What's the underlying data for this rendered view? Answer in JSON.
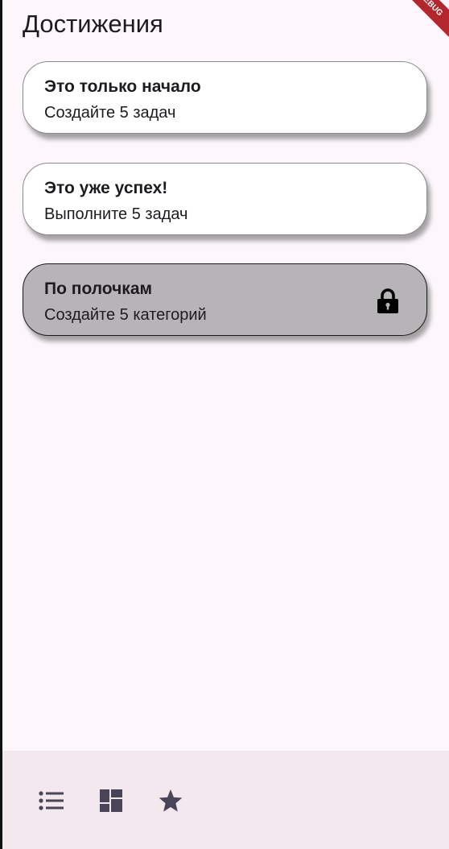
{
  "app": {
    "debug_banner": "DEBUG",
    "title": "Достижения"
  },
  "achievements": [
    {
      "title": "Это только начало",
      "subtitle": "Создайте 5 задач",
      "locked": false
    },
    {
      "title": "Это уже успех!",
      "subtitle": "Выполните 5 задач",
      "locked": false
    },
    {
      "title": "По полочкам",
      "subtitle": "Создайте 5 категорий",
      "locked": true
    }
  ],
  "icons": {
    "lock": "lock-icon",
    "nav_tasks": "list-icon",
    "nav_categories": "dashboard-icon",
    "nav_achievements": "star-icon"
  },
  "colors": {
    "background": "#fdf7fb",
    "card": "#ffffff",
    "locked_card": "#b7b4b7",
    "nav_bar": "#f4e8ef",
    "nav_icon": "#4a4458",
    "debug_banner": "#b3262d"
  }
}
